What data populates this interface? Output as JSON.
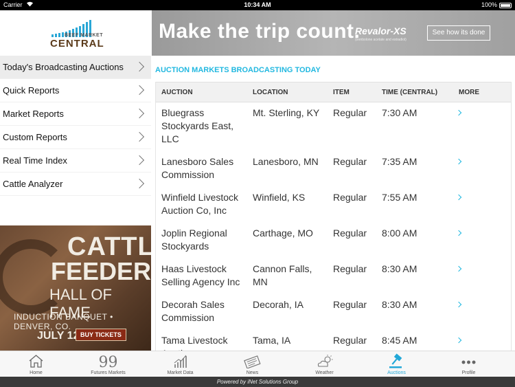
{
  "status_bar": {
    "carrier": "Carrier",
    "time": "10:34 AM",
    "battery": "100%"
  },
  "logo": {
    "top_text": "BEEF MARKET",
    "main_text": "CENTRAL"
  },
  "menu": {
    "items": [
      {
        "label": "Today's Broadcasting Auctions",
        "active": true
      },
      {
        "label": "Quick Reports",
        "active": false
      },
      {
        "label": "Market Reports",
        "active": false
      },
      {
        "label": "Custom Reports",
        "active": false
      },
      {
        "label": "Real Time Index",
        "active": false
      },
      {
        "label": "Cattle Analyzer",
        "active": false
      }
    ]
  },
  "ad_left": {
    "line1": "CATTLE",
    "line2": "FEEDERS",
    "line3": "HALL OF FAME",
    "line4": "INDUCTION BANQUET • DENVER, CO.",
    "date": "JULY 12",
    "button": "BUY TICKETS"
  },
  "ad_top": {
    "headline": "Make the trip count.",
    "brand": "Revalor-XS",
    "brand_sub": "(trenbolone acetate and estradiol)",
    "cta": "See how its done"
  },
  "main": {
    "section_title": "AUCTION MARKETS BROADCASTING TODAY",
    "columns": [
      "AUCTION",
      "LOCATION",
      "ITEM",
      "TIME (CENTRAL)",
      "MORE"
    ],
    "rows": [
      {
        "auction": "Bluegrass Stockyards East, LLC",
        "location": "Mt. Sterling, KY",
        "item": "Regular",
        "time": "7:30 AM"
      },
      {
        "auction": "Lanesboro Sales Commission",
        "location": "Lanesboro, MN",
        "item": "Regular",
        "time": "7:35 AM"
      },
      {
        "auction": "Winfield Livestock Auction Co, Inc",
        "location": "Winfield, KS",
        "item": "Regular",
        "time": "7:55 AM"
      },
      {
        "auction": "Joplin Regional Stockyards",
        "location": "Carthage, MO",
        "item": "Regular",
        "time": "8:00 AM"
      },
      {
        "auction": "Haas Livestock Selling Agency Inc",
        "location": "Cannon Falls, MN",
        "item": "Regular",
        "time": "8:30 AM"
      },
      {
        "auction": "Decorah Sales Commission",
        "location": "Decorah, IA",
        "item": "Regular",
        "time": "8:30 AM"
      },
      {
        "auction": "Tama Livestock Auction",
        "location": "Tama, IA",
        "item": "Regular",
        "time": "8:45 AM"
      }
    ]
  },
  "tabs": [
    {
      "label": "Home",
      "icon": "home-icon",
      "active": false
    },
    {
      "label": "Futures Markets",
      "icon": "quote-icon",
      "active": false
    },
    {
      "label": "Market Data",
      "icon": "chart-icon",
      "active": false
    },
    {
      "label": "News",
      "icon": "newspaper-icon",
      "active": false
    },
    {
      "label": "Weather",
      "icon": "weather-icon",
      "active": false
    },
    {
      "label": "Auctions",
      "icon": "gavel-icon",
      "active": true
    },
    {
      "label": "Profile",
      "icon": "more-icon",
      "active": false
    }
  ],
  "footer": {
    "text": "Powered by iNet Solutions Group"
  },
  "colors": {
    "accent": "#22b8e0",
    "active_menu_bg": "#ececec",
    "footer_bg": "#3a3a3a"
  }
}
